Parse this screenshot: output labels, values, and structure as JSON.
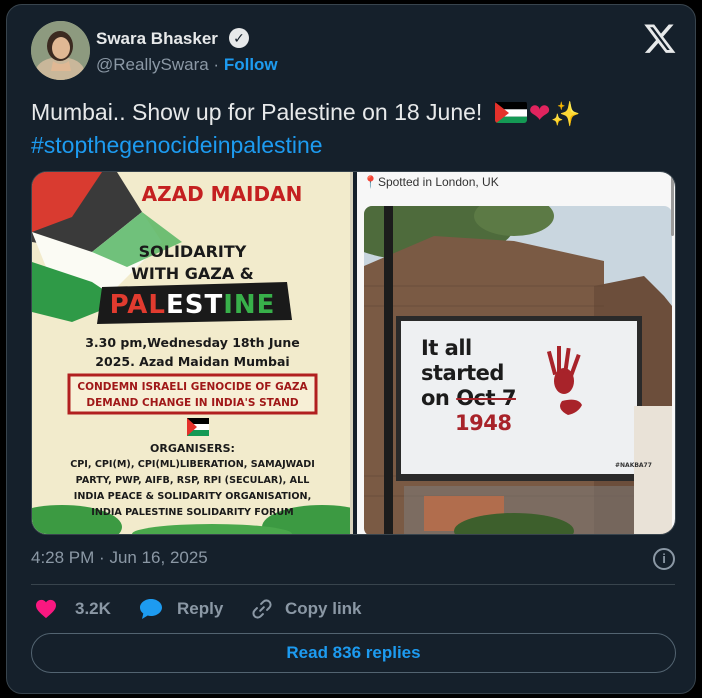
{
  "author": {
    "name": "Swara Bhasker",
    "handle": "@ReallySwara",
    "separator": "·",
    "follow_label": "Follow"
  },
  "tweet": {
    "text": "Mumbai.. Show up for Palestine on 18 June!",
    "hashtag": "#stopthegenocideinpalestine",
    "emojis": [
      "palestine-flag",
      "red-heart",
      "sparkles"
    ]
  },
  "poster": {
    "venue": "AZAD MAIDAN",
    "line1": "SOLIDARITY",
    "line2": "WITH GAZA &",
    "palestine_a": "PAL",
    "palestine_b": "EST",
    "palestine_c": "INE",
    "datetime1": "3.30 pm,Wednesday 18th June",
    "datetime2": "2025.  Azad Maidan Mumbai",
    "demand1": "CONDEMN ISRAELI GENOCIDE OF GAZA",
    "demand2": "DEMAND CHANGE IN INDIA'S STAND",
    "organisers_title": "ORGANISERS:",
    "org1": "CPI, CPI(M), CPI(ML)LIBERATION, SAMAJWADI",
    "org2": "PARTY, PWP, AIFB, RSP, RPI (SECULAR), ALL",
    "org3": "INDIA PEACE & SOLIDARITY ORGANISATION,",
    "org4": "INDIA PALESTINE SOLIDARITY FORUM"
  },
  "photo": {
    "caption": "Spotted in London, UK",
    "billboard_line1": "It all",
    "billboard_line2": "started",
    "billboard_on": "on",
    "billboard_struck": "Oct 7",
    "billboard_year": "1948",
    "billboard_tag": "#NAKBA77"
  },
  "meta": {
    "time": "4:28 PM",
    "separator": "·",
    "date": "Jun 16, 2025"
  },
  "actions": {
    "likes": "3.2K",
    "reply_label": "Reply",
    "copy_link_label": "Copy link"
  },
  "read_replies_label": "Read 836 replies",
  "colors": {
    "background": "#15202b",
    "accent": "#1d9bf0",
    "like": "#f91880",
    "muted": "#8b98a5",
    "text": "#e7e9ea"
  }
}
